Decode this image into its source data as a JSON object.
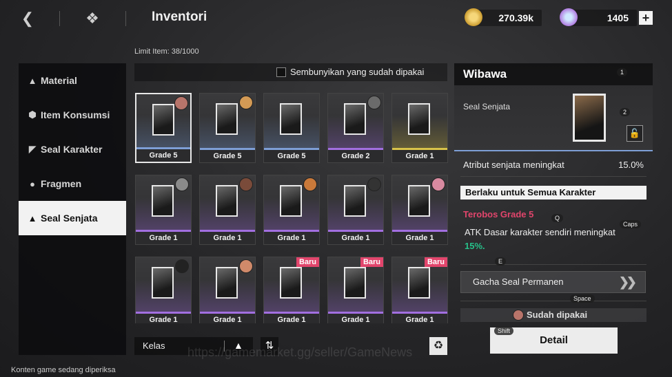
{
  "topbar": {
    "title": "Inventori",
    "gold": "270.39k",
    "gems": "1405",
    "plus": "+"
  },
  "limit_label": "Limit Item:",
  "limit_value": "38/1000",
  "nav": {
    "items": [
      {
        "label": "Material",
        "icon": "material-icon"
      },
      {
        "label": "Item Konsumsi",
        "icon": "consumable-icon"
      },
      {
        "label": "Seal Karakter",
        "icon": "character-seal-icon"
      },
      {
        "label": "Fragmen",
        "icon": "fragment-icon"
      },
      {
        "label": "Seal Senjata",
        "icon": "weapon-seal-icon"
      }
    ],
    "active": "Seal Senjata"
  },
  "filter": {
    "hide_used_label": "Sembunyikan yang sudah dipakai"
  },
  "grid": {
    "cards": [
      {
        "grade": "Grade 5",
        "rarity": "blue",
        "avatar": true,
        "baru": ""
      },
      {
        "grade": "Grade 5",
        "rarity": "blue",
        "avatar": true,
        "baru": ""
      },
      {
        "grade": "Grade 5",
        "rarity": "blue",
        "avatar": false,
        "baru": ""
      },
      {
        "grade": "Grade 2",
        "rarity": "purple",
        "avatar": true,
        "baru": ""
      },
      {
        "grade": "Grade 1",
        "rarity": "gold",
        "avatar": false,
        "baru": ""
      },
      {
        "grade": "Grade 1",
        "rarity": "purple",
        "avatar": true,
        "baru": ""
      },
      {
        "grade": "Grade 1",
        "rarity": "purple",
        "avatar": true,
        "baru": ""
      },
      {
        "grade": "Grade 1",
        "rarity": "purple",
        "avatar": true,
        "baru": ""
      },
      {
        "grade": "Grade 1",
        "rarity": "purple",
        "avatar": true,
        "baru": ""
      },
      {
        "grade": "Grade 1",
        "rarity": "purple",
        "avatar": true,
        "baru": ""
      },
      {
        "grade": "Grade 1",
        "rarity": "purple",
        "avatar": true,
        "baru": ""
      },
      {
        "grade": "Grade 1",
        "rarity": "purple",
        "avatar": true,
        "baru": ""
      },
      {
        "grade": "Grade 1",
        "rarity": "purple",
        "avatar": false,
        "baru": "Baru"
      },
      {
        "grade": "Grade 1",
        "rarity": "purple",
        "avatar": false,
        "baru": "Baru"
      },
      {
        "grade": "Grade 1",
        "rarity": "purple",
        "avatar": false,
        "baru": "Baru"
      }
    ],
    "selected_index": 0
  },
  "sort": {
    "label": "Kelas",
    "arrow": "▲",
    "swap_icon": "⇅"
  },
  "detail": {
    "title": "Wibawa",
    "subtitle": "Seal Senjata",
    "stat_label": "Atribut senjata meningkat",
    "stat_value": "15.0%",
    "apply_label": "Berlaku untuk Semua Karakter",
    "break_title": "Terobos Grade 5",
    "break_desc": "ATK Dasar karakter sendiri meningkat",
    "break_value": "15%.",
    "gacha_label": "Gacha Seal Permanen",
    "equipped_label": "Sudah dipakai",
    "detail_button": "Detail"
  },
  "keyhints": {
    "k1": "1",
    "k2": "2",
    "q": "Q",
    "caps": "Caps",
    "e": "E",
    "space": "Space",
    "shift": "Shift"
  },
  "status": "Konten game sedang diperiksa",
  "watermark": "https://gamemarket.gg/seller/GameNews",
  "colors": {
    "blue": "#7e9fd6",
    "purple": "#a26fe0",
    "gold": "#d8c34a",
    "baru": "#e2456c",
    "highlight_green": "#27c08a"
  }
}
